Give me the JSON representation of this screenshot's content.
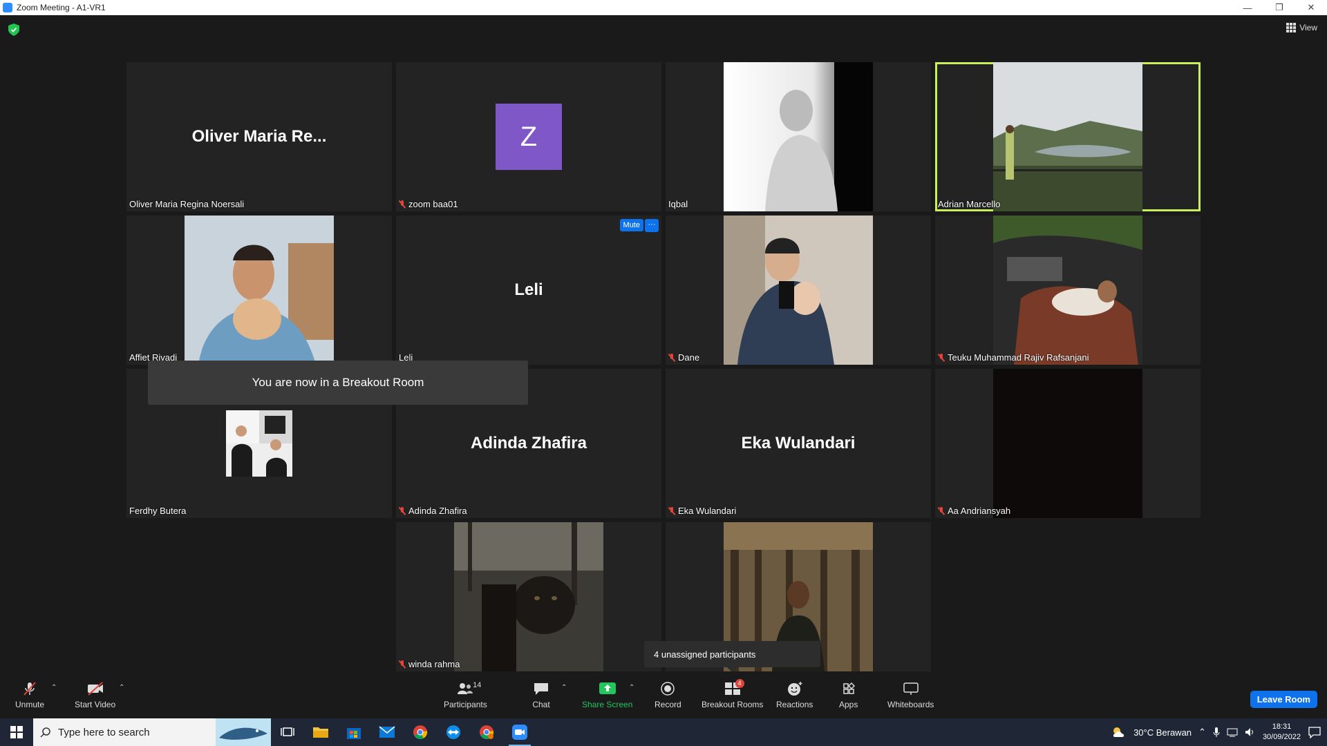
{
  "window": {
    "title": "Zoom Meeting - A1-VR1",
    "minimize": "—",
    "restore": "❐",
    "close": "✕"
  },
  "top": {
    "view_label": "View"
  },
  "tiles": [
    {
      "display_name": "Oliver Maria Re...",
      "label": "Oliver Maria Regina Noersali",
      "muted": false
    },
    {
      "avatar_letter": "Z",
      "label": "zoom baa01",
      "muted": true
    },
    {
      "label": "Iqbal",
      "muted": false
    },
    {
      "label": "Adrian Marcello",
      "muted": false,
      "active_speaker": true
    },
    {
      "label": "Affiet Rivadi",
      "muted": false
    },
    {
      "display_name": "Leli",
      "label": "Leli",
      "muted": false,
      "mute_button": "Mute",
      "more_button": "···"
    },
    {
      "label": "Dane",
      "muted": true
    },
    {
      "label": "Teuku Muhammad Rajiv Rafsanjani",
      "muted": true
    },
    {
      "label": "Ferdhy Butera",
      "muted": false
    },
    {
      "display_name": "Adinda Zhafira",
      "label": "Adinda Zhafira",
      "muted": true
    },
    {
      "display_name": "Eka Wulandari",
      "label": "Eka Wulandari",
      "muted": true
    },
    {
      "label": "Aa Andriansyah",
      "muted": true
    },
    {
      "label": "winda rahma",
      "muted": true
    },
    {
      "label": "",
      "muted": false
    }
  ],
  "breakout_banner": "You are now in a Breakout Room",
  "unassigned_tooltip": "4 unassigned participants",
  "toolbar": {
    "unmute": "Unmute",
    "start_video": "Start Video",
    "participants": "Participants",
    "participants_count": "14",
    "chat": "Chat",
    "share_screen": "Share Screen",
    "record": "Record",
    "breakout_rooms": "Breakout Rooms",
    "breakout_badge": "4",
    "reactions": "Reactions",
    "apps": "Apps",
    "whiteboards": "Whiteboards",
    "leave": "Leave Room"
  },
  "taskbar": {
    "search_placeholder": "Type here to search",
    "weather": "30°C  Berawan",
    "time": "18:31",
    "date": "30/09/2022"
  },
  "colors": {
    "accent": "#0e72ed",
    "active_speaker": "#c9f05a",
    "muted": "#e0453a",
    "share": "#22c55e",
    "avatar": "#7f57c7"
  }
}
